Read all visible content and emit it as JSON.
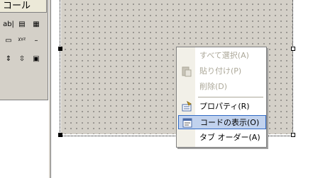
{
  "toolbox": {
    "tab_label": "コール",
    "tools": [
      {
        "name": "label-tool-icon",
        "glyph": "ab|"
      },
      {
        "name": "frame-tool-icon",
        "glyph": "▤"
      },
      {
        "name": "listbox-tool-icon",
        "glyph": "▦"
      },
      {
        "name": "commandbutton-tool-icon",
        "glyph": "▭"
      },
      {
        "name": "textbox-tool-icon",
        "glyph": "ᵡᵞᶻ"
      },
      {
        "name": "checkbox-tool-icon",
        "glyph": "–"
      },
      {
        "name": "spinbutton-tool-icon",
        "glyph": "⇕"
      },
      {
        "name": "scrollbar-tool-icon",
        "glyph": "⇳"
      },
      {
        "name": "image-tool-icon",
        "glyph": "▣"
      }
    ]
  },
  "context_menu": {
    "items": [
      {
        "label": "すべて選択(A)",
        "enabled": false
      },
      {
        "label": "貼り付け(P)",
        "enabled": false,
        "icon": "paste-icon"
      },
      {
        "label": "削除(D)",
        "enabled": false
      },
      {
        "label": "プロパティ(R)",
        "enabled": true,
        "icon": "properties-icon"
      },
      {
        "label": "コードの表示(O)",
        "enabled": true,
        "icon": "view-code-icon",
        "selected": true
      },
      {
        "label": "タブ オーダー(A)",
        "enabled": true
      }
    ]
  },
  "colors": {
    "selection_border": "#316ac5",
    "selection_fill": "#c1d2ee",
    "disabled_text": "#aca899"
  }
}
